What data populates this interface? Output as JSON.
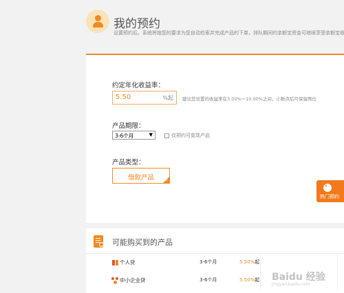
{
  "header": {
    "title": "我的预约",
    "description": "设置预约后，系统将按您的要求为您自动检索并完成产品的下单，排队期间的余额宝资金可继续享受余额宝收益"
  },
  "form": {
    "rate_label": "约定年化收益率：",
    "rate_value": "5.50",
    "rate_unit": "%起",
    "rate_hint": "建议您设置的收益率在3.00%～10.00%之间，小数点后可保留两位",
    "term_label": "产品期限：",
    "term_selected": "3-6个月",
    "transferable_label": "仅预约可变现产品",
    "transferable_checked": false,
    "type_label": "产品类型：",
    "type_option": "借款产品"
  },
  "hot_tab": {
    "label": "热门预约"
  },
  "products": {
    "title": "可能购买到的产品",
    "rows": [
      {
        "name": "个人贷",
        "term": "3-6个月",
        "rate": "5.50%",
        "rate_suffix": "起"
      },
      {
        "name": "中小企业贷",
        "term": "3-6个月",
        "rate": "5.50%",
        "rate_suffix": "起"
      }
    ]
  },
  "watermark": {
    "text": "Baidu 经验",
    "sub": "jingyan.baidu.com"
  },
  "colors": {
    "accent": "#f08a24",
    "background": "#f2f2f2"
  }
}
